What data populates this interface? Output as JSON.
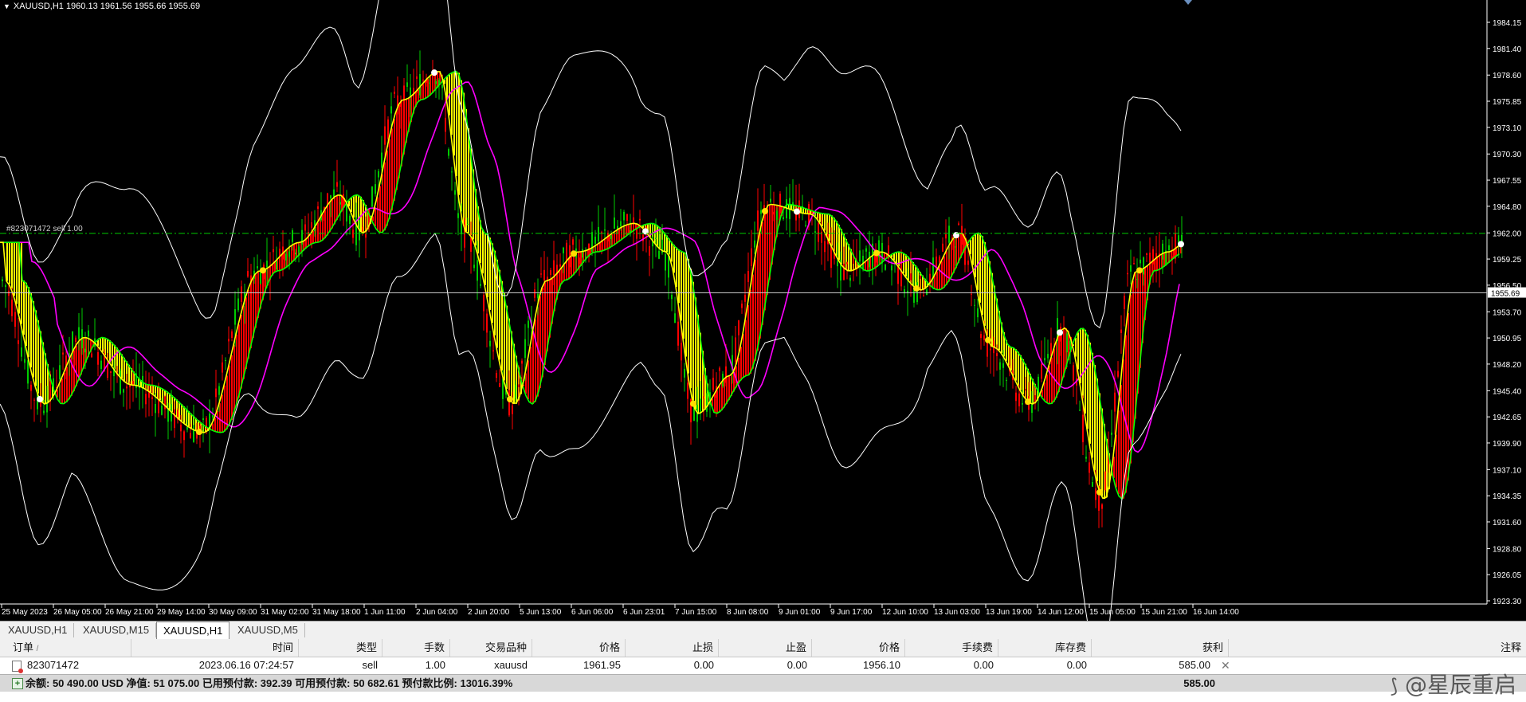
{
  "chart": {
    "symbol_info": "XAUUSD,H1  1960.13 1961.56 1955.66 1955.69",
    "order_line_label": "#823071472 sell 1.00",
    "current_price_label": "1955.69",
    "price_ticks": [
      "1984.15",
      "1981.40",
      "1978.60",
      "1975.85",
      "1973.10",
      "1970.30",
      "1967.55",
      "1964.80",
      "1962.00",
      "1959.25",
      "1956.50",
      "1953.70",
      "1950.95",
      "1948.20",
      "1945.40",
      "1942.65",
      "1939.90",
      "1937.10",
      "1934.35",
      "1931.60",
      "1928.80",
      "1926.05",
      "1923.30"
    ],
    "time_ticks": [
      "25 May 2023",
      "26 May 05:00",
      "26 May 21:00",
      "29 May 14:00",
      "30 May 09:00",
      "31 May 02:00",
      "31 May 18:00",
      "1 Jun 11:00",
      "2 Jun 04:00",
      "2 Jun 20:00",
      "5 Jun 13:00",
      "6 Jun 06:00",
      "6 Jun 23:01",
      "7 Jun 15:00",
      "8 Jun 08:00",
      "9 Jun 01:00",
      "9 Jun 17:00",
      "12 Jun 10:00",
      "13 Jun 03:00",
      "13 Jun 19:00",
      "14 Jun 12:00",
      "15 Jun 05:00",
      "15 Jun 21:00",
      "16 Jun 14:00"
    ],
    "colors": {
      "bg": "#000000",
      "bull": "#00cc00",
      "bear": "#ff0000",
      "fill_up": "#ff0000",
      "fill_down": "#ffff00",
      "ma_fast": "#ffff00",
      "ma_mid": "#00ff00",
      "ma_slow": "#ff00ff",
      "bands": "#ffffff",
      "order_line": "#00cc00"
    }
  },
  "tabs": [
    {
      "label": "XAUUSD,H1",
      "active": false
    },
    {
      "label": "XAUUSD,M15",
      "active": false
    },
    {
      "label": "XAUUSD,H1",
      "active": true
    },
    {
      "label": "XAUUSD,M5",
      "active": false
    }
  ],
  "table": {
    "headers": {
      "order": "订单",
      "time": "时间",
      "type": "类型",
      "lots": "手数",
      "symbol": "交易品种",
      "price": "价格",
      "sl": "止损",
      "tp": "止盈",
      "price2": "价格",
      "commission": "手续费",
      "swap": "库存费",
      "profit": "获利",
      "comment": "注释"
    },
    "row": {
      "order": "823071472",
      "time": "2023.06.16 07:24:57",
      "type": "sell",
      "lots": "1.00",
      "symbol": "xauusd",
      "price": "1961.95",
      "sl": "0.00",
      "tp": "0.00",
      "price2": "1956.10",
      "commission": "0.00",
      "swap": "0.00",
      "profit": "585.00"
    },
    "summary": {
      "text": "余额: 50 490.00 USD  净值: 51 075.00  已用预付款: 392.39  可用预付款: 50 682.61  预付款比例: 13016.39%",
      "profit": "585.00"
    }
  },
  "watermark": "@星辰重启"
}
